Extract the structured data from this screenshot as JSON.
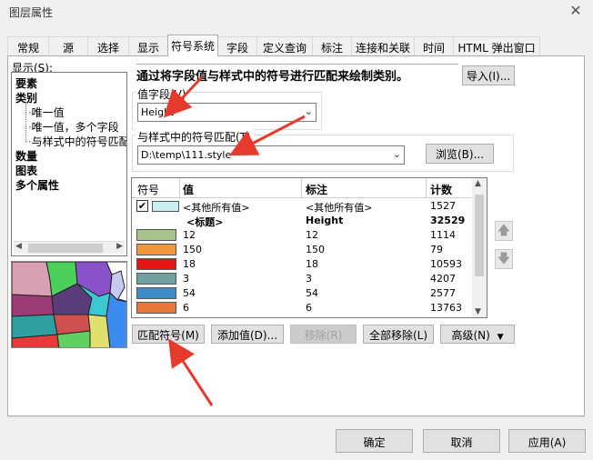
{
  "window": {
    "title": "图层属性",
    "close_glyph": "✕"
  },
  "tabs": [
    {
      "label": "常规"
    },
    {
      "label": "源"
    },
    {
      "label": "选择"
    },
    {
      "label": "显示"
    },
    {
      "label": "符号系统",
      "active": true
    },
    {
      "label": "字段"
    },
    {
      "label": "定义查询"
    },
    {
      "label": "标注"
    },
    {
      "label": "连接和关联"
    },
    {
      "label": "时间"
    },
    {
      "label": "HTML 弹出窗口"
    }
  ],
  "show_panel": {
    "label": "显示(S):",
    "tree": [
      {
        "label": "要素",
        "level": 0
      },
      {
        "label": "类别",
        "level": 0
      },
      {
        "label": "唯一值",
        "level": 1
      },
      {
        "label": "唯一值，多个字段",
        "level": 1
      },
      {
        "label": "与样式中的符号匹配",
        "level": 1
      },
      {
        "label": "数量",
        "level": 0
      },
      {
        "label": "图表",
        "level": 0
      },
      {
        "label": "多个属性",
        "level": 0
      }
    ]
  },
  "main": {
    "heading": "通过将字段值与样式中的符号进行匹配来绘制类别。",
    "import_label": "导入(I)...",
    "value_field": {
      "label": "值字段(V)",
      "value": "Height"
    },
    "style_match": {
      "label": "与样式中的符号匹配(T)",
      "value": "D:\\temp\\111.style"
    },
    "browse_label": "浏览(B)...",
    "grid": {
      "headers": [
        "符号",
        "值",
        "标注",
        "计数"
      ],
      "rows": [
        {
          "checked": true,
          "color": "#c8f0f0",
          "value": "<其他所有值>",
          "label": "<其他所有值>",
          "count": "1527"
        },
        {
          "heading": true,
          "value": "<标题>",
          "label": "Height",
          "count": "32529"
        },
        {
          "color": "#a8c48c",
          "value": "12",
          "label": "12",
          "count": "1114"
        },
        {
          "color": "#f0963c",
          "value": "150",
          "label": "150",
          "count": "79"
        },
        {
          "color": "#e61414",
          "value": "18",
          "label": "18",
          "count": "10593"
        },
        {
          "color": "#6ea0a0",
          "value": "3",
          "label": "3",
          "count": "4207"
        },
        {
          "color": "#3c8cc8",
          "value": "54",
          "label": "54",
          "count": "2577"
        },
        {
          "color": "#e6783c",
          "value": "6",
          "label": "6",
          "count": "13763"
        }
      ]
    },
    "buttons": {
      "match": "匹配符号(M)",
      "add": "添加值(D)...",
      "remove": "移除(R)",
      "remove_all": "全部移除(L)",
      "advanced": "高级(N)"
    },
    "up_glyph": "🡅",
    "down_glyph": "🡇"
  },
  "footer": {
    "ok": "确定",
    "cancel": "取消",
    "apply": "应用(A)"
  }
}
